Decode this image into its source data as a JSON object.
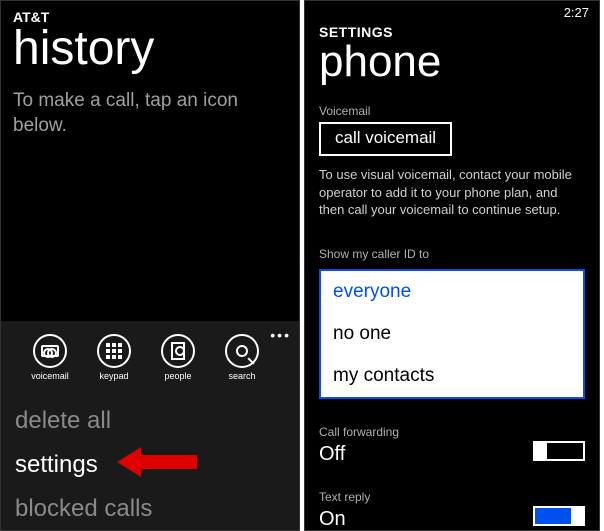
{
  "left": {
    "carrier": "AT&T",
    "title": "history",
    "hint": "To make a call, tap an icon below.",
    "appbar": {
      "voicemail": "voicemail",
      "keypad": "keypad",
      "people": "people",
      "search": "search"
    },
    "menu": {
      "delete_all": "delete all",
      "settings": "settings",
      "blocked_calls": "blocked calls"
    }
  },
  "right": {
    "time": "2:27",
    "crumb": "SETTINGS",
    "title": "phone",
    "voicemail_label": "Voicemail",
    "voicemail_button": "call voicemail",
    "voicemail_note": "To use visual voicemail, contact your mobile operator to add it to your phone plan, and then call your voicemail to continue setup.",
    "callerid_label": "Show my caller ID to",
    "callerid_options": {
      "everyone": "everyone",
      "no_one": "no one",
      "my_contacts": "my contacts"
    },
    "call_fwd_label": "Call forwarding",
    "call_fwd_value": "Off",
    "text_reply_label": "Text reply",
    "text_reply_value": "On"
  }
}
